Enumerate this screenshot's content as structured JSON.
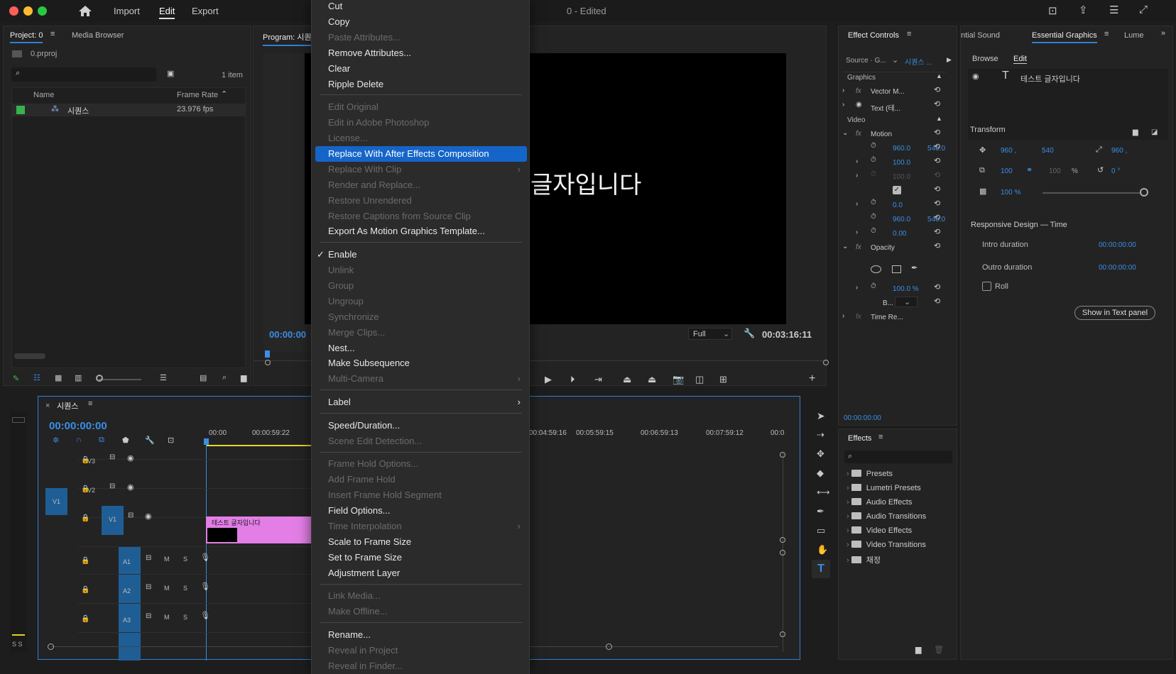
{
  "window": {
    "title": "0 - Edited",
    "nav": {
      "import": "Import",
      "edit": "Edit",
      "export": "Export"
    }
  },
  "project": {
    "tab_project": "Project: 0",
    "tab_media": "Media Browser",
    "file": "0.prproj",
    "count": "1 item",
    "col_name": "Name",
    "col_rate": "Frame Rate",
    "item_name": "시퀀스",
    "item_rate": "23.976 fps"
  },
  "program": {
    "tab": "Program: 시퀀",
    "timecode_left": "00:00:00",
    "fit": "Full",
    "timecode_right": "00:03:16:11",
    "overlay_text": "글자입니다"
  },
  "context_menu": {
    "items": [
      {
        "label": "Cut",
        "disabled": false
      },
      {
        "label": "Copy",
        "disabled": false
      },
      {
        "label": "Paste Attributes...",
        "disabled": true
      },
      {
        "label": "Remove Attributes...",
        "disabled": false
      },
      {
        "label": "Clear",
        "disabled": false
      },
      {
        "label": "Ripple Delete",
        "disabled": false
      },
      {
        "label": "Edit Original",
        "disabled": true
      },
      {
        "label": "Edit in Adobe Photoshop",
        "disabled": true
      },
      {
        "label": "License...",
        "disabled": true
      },
      {
        "label": "Replace With After Effects Composition",
        "disabled": false,
        "highlighted": true
      },
      {
        "label": "Replace With Clip",
        "disabled": true,
        "submenu": true
      },
      {
        "label": "Render and Replace...",
        "disabled": true
      },
      {
        "label": "Restore Unrendered",
        "disabled": true
      },
      {
        "label": "Restore Captions from Source Clip",
        "disabled": true
      },
      {
        "label": "Export As Motion Graphics Template...",
        "disabled": false
      },
      {
        "label": "Enable",
        "disabled": false,
        "checked": true
      },
      {
        "label": "Unlink",
        "disabled": true
      },
      {
        "label": "Group",
        "disabled": true
      },
      {
        "label": "Ungroup",
        "disabled": true
      },
      {
        "label": "Synchronize",
        "disabled": true
      },
      {
        "label": "Merge Clips...",
        "disabled": true
      },
      {
        "label": "Nest...",
        "disabled": false
      },
      {
        "label": "Make Subsequence",
        "disabled": false
      },
      {
        "label": "Multi-Camera",
        "disabled": true,
        "submenu": true
      },
      {
        "label": "Label",
        "disabled": false,
        "submenu": true
      },
      {
        "label": "Speed/Duration...",
        "disabled": false
      },
      {
        "label": "Scene Edit Detection...",
        "disabled": true
      },
      {
        "label": "Frame Hold Options...",
        "disabled": true
      },
      {
        "label": "Add Frame Hold",
        "disabled": true
      },
      {
        "label": "Insert Frame Hold Segment",
        "disabled": true
      },
      {
        "label": "Field Options...",
        "disabled": false
      },
      {
        "label": "Time Interpolation",
        "disabled": true,
        "submenu": true
      },
      {
        "label": "Scale to Frame Size",
        "disabled": false
      },
      {
        "label": "Set to Frame Size",
        "disabled": false
      },
      {
        "label": "Adjustment Layer",
        "disabled": false
      },
      {
        "label": "Link Media...",
        "disabled": true
      },
      {
        "label": "Make Offline...",
        "disabled": true
      },
      {
        "label": "Rename...",
        "disabled": false
      },
      {
        "label": "Reveal in Project",
        "disabled": true
      },
      {
        "label": "Reveal in Finder...",
        "disabled": true
      }
    ]
  },
  "timeline": {
    "tab": "시퀀스",
    "timecode": "00:00:00:00",
    "ruler": [
      "00:00",
      "00:00:59:22",
      "00:04:59:16",
      "00:05:59:15",
      "00:06:59:13",
      "00:07:59:12",
      "00:0"
    ],
    "tracks": [
      "V3",
      "V2",
      "V1",
      "A1",
      "A2",
      "A3"
    ],
    "source_patch": "V1",
    "clip_label": "테스트 글자입니다",
    "audio_m": "M",
    "audio_s": "S",
    "meter_label": "S S"
  },
  "effect_controls": {
    "tab": "Effect Controls",
    "source": "Source · G...",
    "sequence": "시퀀스 ...",
    "graphics": "Graphics",
    "vector": "Vector M...",
    "text": "Text (테...",
    "video": "Video",
    "motion": "Motion",
    "position_x": "960.0",
    "position_y": "540.0",
    "scale": "100.0",
    "scale_w": "100.0",
    "rotation": "0.0",
    "anchor_x": "960.0",
    "anchor_y": "540.0",
    "flicker": "0.00",
    "opacity": "Opacity",
    "opacity_val": "100.0 %",
    "blend": "B...",
    "time_remap": "Time Re...",
    "timecode": "00:00:00:00"
  },
  "effects": {
    "tab": "Effects",
    "items": [
      "Presets",
      "Lumetri Presets",
      "Audio Effects",
      "Audio Transitions",
      "Video Effects",
      "Video Transitions",
      "채정"
    ]
  },
  "essential_graphics": {
    "tab_sound": "ntial Sound",
    "tab_eg": "Essential Graphics",
    "tab_lumetri": "Lume",
    "browse": "Browse",
    "edit": "Edit",
    "layer": "테스트 글자입니다",
    "transform": "Transform",
    "pos_x": "960 ,",
    "pos_y": "540",
    "anchor_x": "960 ,",
    "scale": "100",
    "scale2": "100",
    "pct": "%",
    "rotation": "0 °",
    "opacity": "100 %",
    "responsive": "Responsive Design — Time",
    "intro": "Intro duration",
    "intro_val": "00:00:00:00",
    "outro": "Outro duration",
    "outro_val": "00:00:00:00",
    "roll": "Roll",
    "show_text": "Show in Text panel"
  }
}
